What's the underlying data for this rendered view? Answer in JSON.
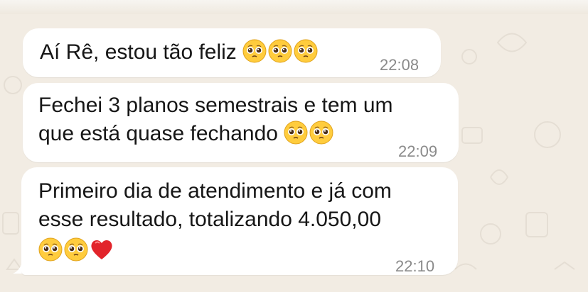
{
  "chat": {
    "messages": [
      {
        "line1": "Aí Rê, estou tão feliz",
        "time": "22:08",
        "emojis": [
          "pleading-face",
          "pleading-face",
          "pleading-face"
        ]
      },
      {
        "line1": "Fechei 3 planos semestrais e tem um",
        "line2": "que está quase fechando",
        "time": "22:09",
        "emojis": [
          "pleading-face",
          "pleading-face"
        ]
      },
      {
        "line1": "Primeiro dia de atendimento e já com",
        "line2": "esse resultado, totalizando 4.050,00",
        "time": "22:10",
        "emojis": [
          "pleading-face",
          "pleading-face",
          "red-heart"
        ]
      }
    ]
  },
  "colors": {
    "bubble": "#ffffff",
    "background": "#f2ece3",
    "timestamp": "#8a8a8a",
    "text": "#161616"
  }
}
